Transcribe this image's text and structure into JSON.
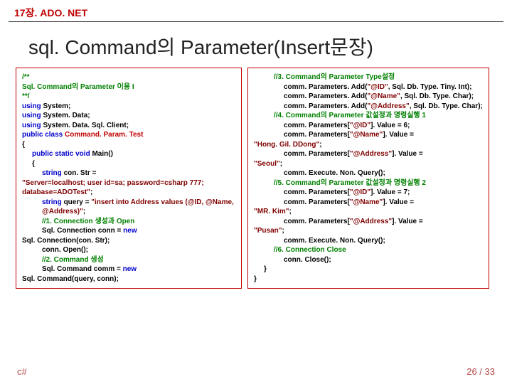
{
  "chapter": "17장. ADO. NET",
  "title": "sql. Command의 Parameter(Insert문장)",
  "left": {
    "l1": "/**",
    "l2": "Sql. Command의 Parameter 이용 I",
    "l3": "**/",
    "l4a": "using ",
    "l4b": "System;",
    "l5a": "using ",
    "l5b": "System. Data;",
    "l6a": "using ",
    "l6b": "System. Data. Sql. Client;",
    "l7a": "public class ",
    "l7b": "Command. Param. Test",
    "l8": "{",
    "l9a": "public static void ",
    "l9b": "Main()",
    "l10": "{",
    "l11a": "string ",
    "l11b": "con. Str = ",
    "l11c": "\"Server=localhost; user id=sa; password=csharp 777; database=ADOTest\"",
    "l11d": ";",
    "l12a": "string ",
    "l12b": "query = ",
    "l12c": "\"insert into Address values (@ID, @Name, @Address)\"",
    "l12d": ";",
    "l13": "//1. Connection 생성과 Open",
    "l14a": "Sql. Connection conn = ",
    "l14b": "new ",
    "l14c": "Sql. Connection(con. Str);",
    "l15": "conn. Open();",
    "l16": "//2. Command 생성",
    "l17a": "Sql. Command comm = ",
    "l17b": "new ",
    "l17c": "Sql. Command(query, conn);"
  },
  "right": {
    "r1": "//3. Command의 Parameter Type설정",
    "r2a": "comm. Parameters. Add(",
    "r2b": "\"@ID\"",
    "r2c": ", Sql. Db. Type. Tiny. Int);",
    "r3a": "comm. Parameters. Add(",
    "r3b": "\"@Name\"",
    "r3c": ", Sql. Db. Type. Char);",
    "r4a": "comm. Parameters. Add(",
    "r4b": "\"@Address\"",
    "r4c": ", Sql. Db. Type. Char);",
    "r5": "//4. Command의 Parameter 값설정과 명령실행 1",
    "r6a": "comm. Parameters[",
    "r6b": "\"@ID\"",
    "r6c": "]. Value = 6;",
    "r7a": "comm. Parameters[",
    "r7b": "\"@Name\"",
    "r7c": "]. Value = ",
    "r7d": "\"Hong. Gil. DDong\"",
    "r7e": ";",
    "r8a": "comm. Parameters[",
    "r8b": "\"@Address\"",
    "r8c": "]. Value = ",
    "r8d": "\"Seoul\"",
    "r8e": ";",
    "r9": "comm. Execute. Non. Query();",
    "r10": "//5. Command의 Parameter 값설정과 명령실행 2",
    "r11a": "comm. Parameters[",
    "r11b": "\"@ID\"",
    "r11c": "]. Value = 7;",
    "r12a": "comm. Parameters[",
    "r12b": "\"@Name\"",
    "r12c": "]. Value = ",
    "r12d": "\"MR. Kim\"",
    "r12e": ";",
    "r13a": "comm. Parameters[",
    "r13b": "\"@Address\"",
    "r13c": "]. Value = ",
    "r13d": "\"Pusan\"",
    "r13e": ";",
    "r14": "comm. Execute. Non. Query();",
    "r15": "//6. Connection Close",
    "r16": "conn. Close();",
    "r17": "}",
    "r18": "}"
  },
  "footer": {
    "left": "c#",
    "right": "26 / 33"
  }
}
